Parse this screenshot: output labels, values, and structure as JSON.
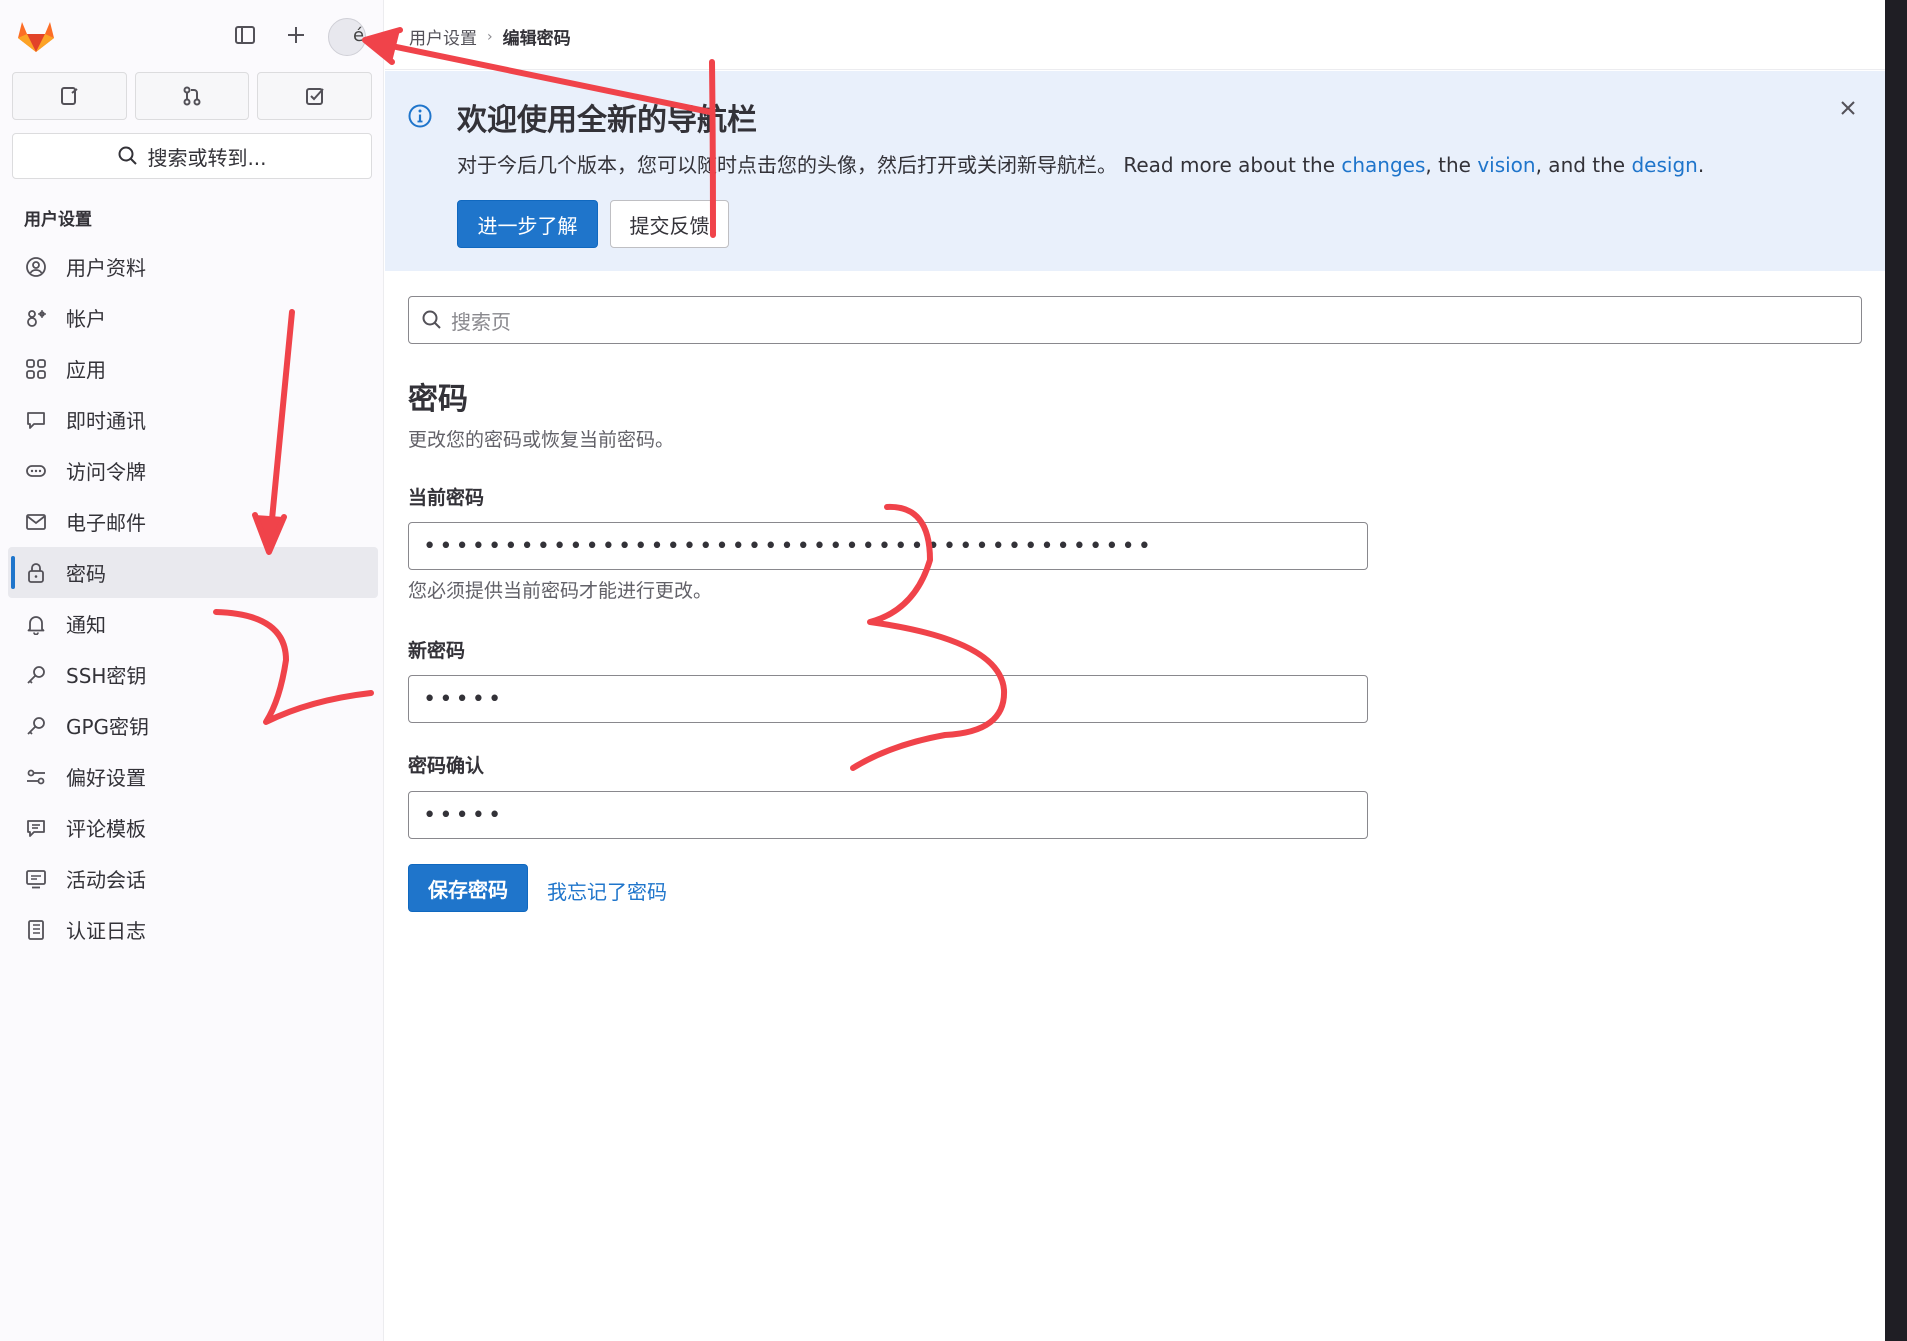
{
  "sidebar": {
    "section_title": "用户设置",
    "search_label": "搜索或转到...",
    "avatar_fallback": "é",
    "items": [
      {
        "label": "用户资料",
        "icon": "user-profile-icon",
        "active": false
      },
      {
        "label": "帐户",
        "icon": "account-icon",
        "active": false
      },
      {
        "label": "应用",
        "icon": "applications-icon",
        "active": false
      },
      {
        "label": "即时通讯",
        "icon": "chat-icon",
        "active": false
      },
      {
        "label": "访问令牌",
        "icon": "token-icon",
        "active": false
      },
      {
        "label": "电子邮件",
        "icon": "mail-icon",
        "active": false
      },
      {
        "label": "密码",
        "icon": "lock-icon",
        "active": true
      },
      {
        "label": "通知",
        "icon": "bell-icon",
        "active": false
      },
      {
        "label": "SSH密钥",
        "icon": "key-icon",
        "active": false
      },
      {
        "label": "GPG密钥",
        "icon": "key-icon",
        "active": false
      },
      {
        "label": "偏好设置",
        "icon": "preferences-icon",
        "active": false
      },
      {
        "label": "评论模板",
        "icon": "comment-template-icon",
        "active": false
      },
      {
        "label": "活动会话",
        "icon": "sessions-icon",
        "active": false
      },
      {
        "label": "认证日志",
        "icon": "log-icon",
        "active": false
      }
    ]
  },
  "breadcrumb": {
    "parent": "用户设置",
    "current": "编辑密码"
  },
  "banner": {
    "title": "欢迎使用全新的导航栏",
    "text_prefix": "对于今后几个版本，您可以随时点击您的头像，然后打开或关闭新导航栏。 Read more about the ",
    "link_changes": "changes",
    "text_mid1": ", the ",
    "link_vision": "vision",
    "text_mid2": ", and the ",
    "link_design": "design",
    "text_suffix": ".",
    "primary_button": "进一步了解",
    "secondary_button": "提交反馈"
  },
  "main": {
    "search_placeholder": "搜索页",
    "title": "密码",
    "description": "更改您的密码或恢复当前密码。",
    "current_password_label": "当前密码",
    "current_password_value": "•••••••••••••••••••••••••••••••••••••••••••••",
    "current_password_help": "您必须提供当前密码才能进行更改。",
    "new_password_label": "新密码",
    "new_password_value": "•••••",
    "confirm_password_label": "密码确认",
    "confirm_password_value": "•••••",
    "save_button": "保存密码",
    "forgot_link": "我忘记了密码"
  },
  "colors": {
    "accent": "#1f75cb",
    "banner_bg": "#e9f0fb",
    "annotation": "#f0434a",
    "logo_orange": "#fc6d26"
  }
}
